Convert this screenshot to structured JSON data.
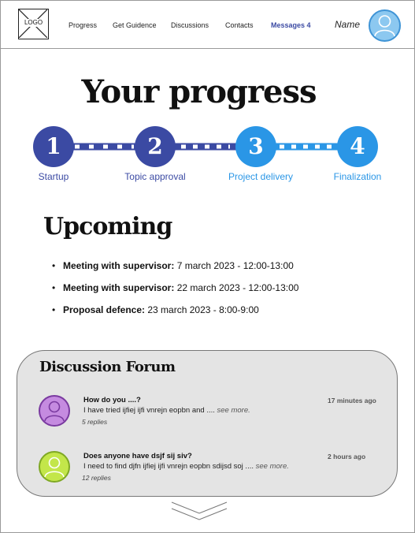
{
  "header": {
    "logo_text": "LOGO",
    "nav": [
      {
        "label": "Progress"
      },
      {
        "label": "Get Guidence"
      },
      {
        "label": "Discussions"
      },
      {
        "label": "Contacts"
      },
      {
        "label": "Messages 4"
      }
    ],
    "user_name": "Name",
    "user_icon": "user-avatar-icon"
  },
  "progress": {
    "title": "Your progress",
    "steps": [
      {
        "number": "1",
        "label": "Startup",
        "status": "done",
        "color": "#3b4aa3"
      },
      {
        "number": "2",
        "label": "Topic approval",
        "status": "done",
        "color": "#3b4aa3"
      },
      {
        "number": "3",
        "label": "Project delivery",
        "status": "current",
        "color": "#2a96e6"
      },
      {
        "number": "4",
        "label": "Finalization",
        "status": "upcoming",
        "color": "#2a96e6"
      }
    ],
    "label_colors": {
      "done": "#3b4aa3",
      "current": "#2a96e6"
    }
  },
  "upcoming": {
    "title": "Upcoming",
    "events": [
      {
        "label": "Meeting with supervisor:",
        "detail": " 7 march 2023 - 12:00-13:00"
      },
      {
        "label": "Meeting with supervisor:",
        "detail": " 22 march 2023 - 12:00-13:00"
      },
      {
        "label": "Proposal defence:",
        "detail": " 23 march 2023 - 8:00-9:00"
      }
    ]
  },
  "forum": {
    "title": "Discussion Forum",
    "posts": [
      {
        "title": "How do you ....?",
        "text": "I have tried ijfiej ijfi vnrejn eopbn and .... ",
        "more": "see more.",
        "replies": "5 replies",
        "time": "17 minutes ago",
        "avatar_color": "#c58be0",
        "avatar_border": "#7a3aa0"
      },
      {
        "title": "Does anyone have dsjf sij siv?",
        "text": "I need to find djfn ijfiej ijfi vnrejn eopbn sdijsd soj  .... ",
        "more": "see more.",
        "replies": "12 replies",
        "time": "2 hours ago",
        "avatar_color": "#c3e64a",
        "avatar_border": "#7fa824"
      }
    ]
  },
  "footer": {
    "expand_icon": "chevron-down-icon"
  }
}
